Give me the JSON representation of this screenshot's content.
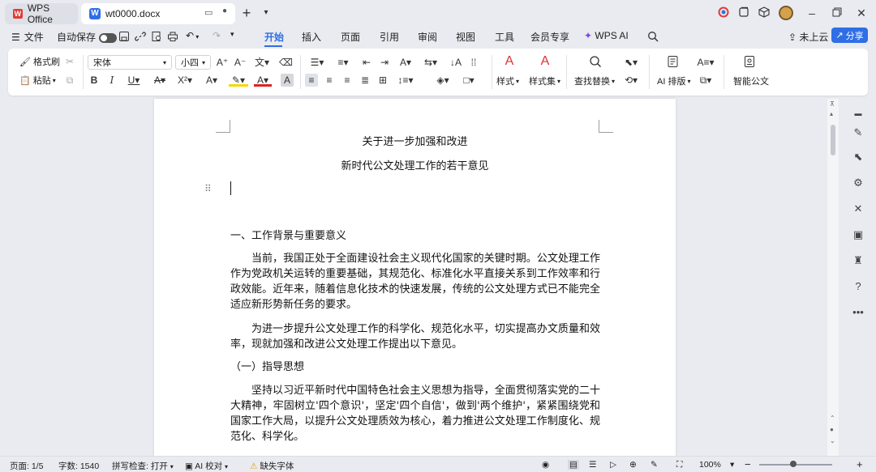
{
  "titlebar": {
    "app_tab": "WPS Office",
    "doc_tab": "wt0000.docx",
    "add_symbol": "+"
  },
  "menubar": {
    "file": "文件",
    "autosave": "自动保存",
    "tabs": [
      "开始",
      "插入",
      "页面",
      "引用",
      "审阅",
      "视图",
      "工具",
      "会员专享",
      "WPS AI"
    ],
    "active_tab": "开始",
    "cloud": "未上云",
    "share": "分享"
  },
  "ribbon": {
    "format_painter": "格式刷",
    "paste": "粘贴",
    "font_family": "宋体",
    "font_size": "小四",
    "styles": "样式",
    "style_set": "样式集",
    "find_replace": "查找替换",
    "ai_layout": "AI 排版",
    "smart_doc": "智能公文"
  },
  "document": {
    "title_line1": "关于进一步加强和改进",
    "title_line2": "新时代公文处理工作的若干意见",
    "heading1": "一、工作背景与重要意义",
    "para1": "当前，我国正处于全面建设社会主义现代化国家的关键时期。公文处理工作作为党政机关运转的重要基础，其规范化、标准化水平直接关系到工作效率和行政效能。近年来，随着信息化技术的快速发展，传统的公文处理方式已不能完全适应新形势新任务的要求。",
    "para2": "为进一步提升公文处理工作的科学化、规范化水平，切实提高办文质量和效率，现就加强和改进公文处理工作提出以下意见。",
    "heading2": "（一）指导思想",
    "para3": "坚持以习近平新时代中国特色社会主义思想为指导，全面贯彻落实党的二十大精神，牢固树立'四个意识'，坚定'四个自信'，做到'两个维护'，紧紧围绕党和国家工作大局，以提升公文处理质效为核心，着力推进公文处理工作制度化、规范化、科学化。"
  },
  "statusbar": {
    "page": "页面: 1/5",
    "words": "字数: 1540",
    "spell": "拼写检查: 打开",
    "ai_check": "AI 校对",
    "missing_font": "缺失字体",
    "zoom": "100%"
  },
  "colors": {
    "accent": "#2f6ee5",
    "wps_red": "#e23b35",
    "bg": "#e9ebf0"
  }
}
